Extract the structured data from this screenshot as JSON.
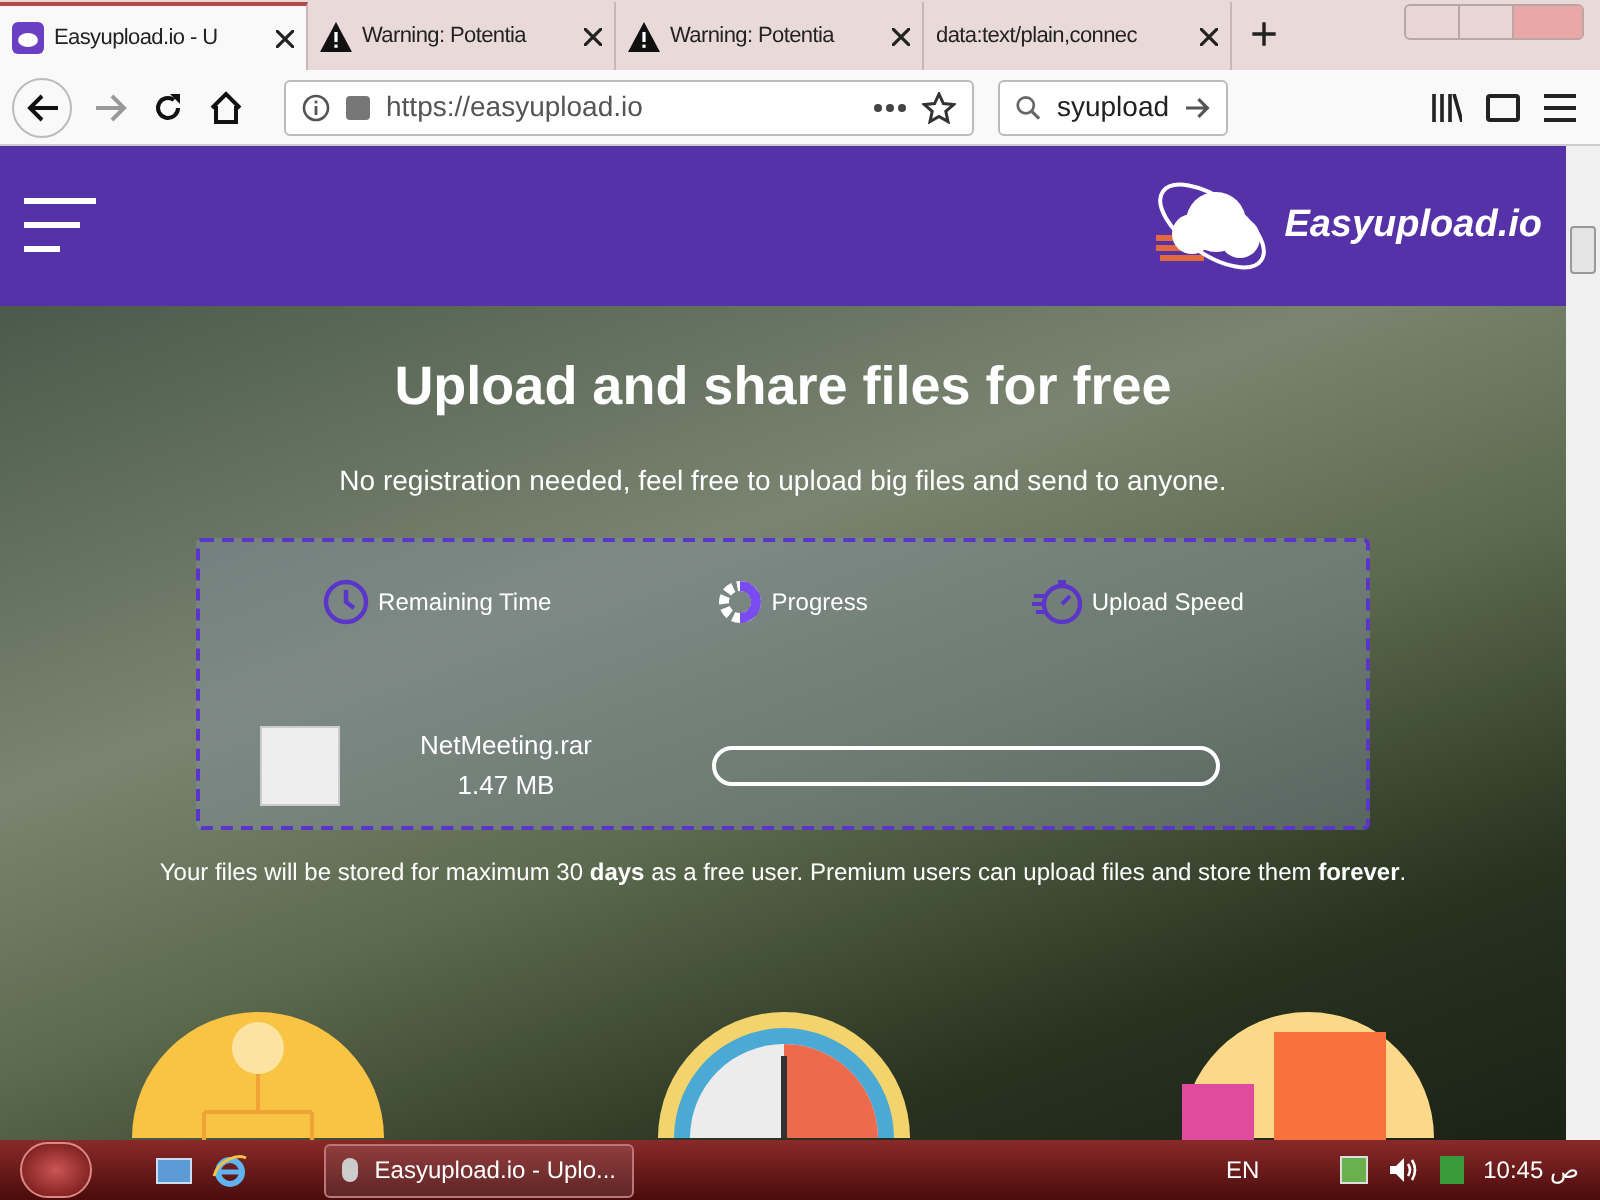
{
  "browser": {
    "tabs": [
      {
        "title": "Easyupload.io - U",
        "kind": "site",
        "selected": true
      },
      {
        "title": "Warning: Potentia",
        "kind": "warning",
        "selected": false
      },
      {
        "title": "Warning: Potentia",
        "kind": "warning",
        "selected": false
      },
      {
        "title": "data:text/plain,connec",
        "kind": "plain",
        "selected": false
      }
    ],
    "new_tab": "+",
    "url": "https://easyupload.io",
    "search": "syupload"
  },
  "header": {
    "logo": "Easyupload.io"
  },
  "hero": {
    "title": "Upload and share files for free",
    "subtitle": "No registration needed, feel free to upload big files and send to anyone."
  },
  "upload_panel": {
    "stats": [
      {
        "kind": "time",
        "label": "Remaining Time"
      },
      {
        "kind": "progress",
        "label": "Progress"
      },
      {
        "kind": "speed",
        "label": "Upload Speed"
      }
    ],
    "file": {
      "name": "NetMeeting.rar",
      "size": "1.47 MB",
      "level": 0
    }
  },
  "notice": "Your files will be stored for maximum 30 **days** as a free user. Premium users can upload files and store them **forever**.",
  "taskbar": {
    "window": "Easyupload.io - Uplo...",
    "language": "EN",
    "time": "10:45 ص"
  }
}
